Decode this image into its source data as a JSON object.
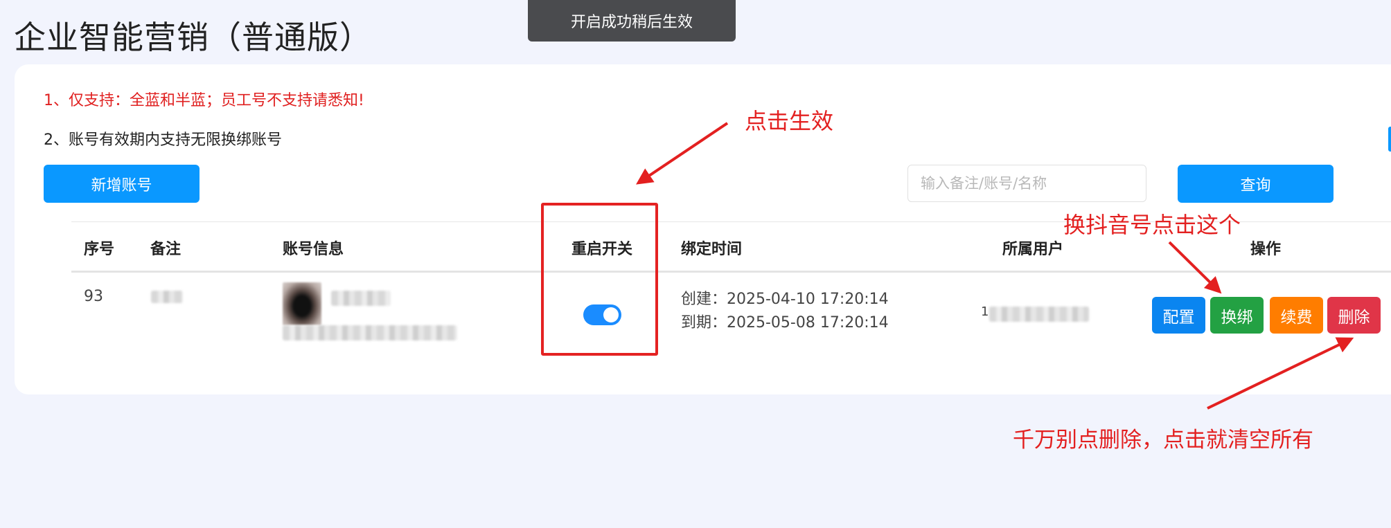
{
  "page": {
    "title": "企业智能营销（普通版）"
  },
  "toast": {
    "message": "开启成功稍后生效"
  },
  "notices": {
    "line1": "1、仅支持：全蓝和半蓝；员工号不支持请悉知!",
    "line2": "2、账号有效期内支持无限换绑账号"
  },
  "toolbar": {
    "add_label": "新增账号",
    "search_placeholder": "输入备注/账号/名称",
    "search_value": "",
    "query_label": "查询"
  },
  "table": {
    "headers": {
      "index": "序号",
      "remark": "备注",
      "account": "账号信息",
      "restart": "重启开关",
      "bind_time": "绑定时间",
      "owner": "所属用户",
      "actions": "操作"
    },
    "rows": [
      {
        "index": "93",
        "created": "创建：2025-04-10 17:20:14",
        "expires": "到期：2025-05-08 17:20:14",
        "owner_prefix": "1",
        "restart_on": true,
        "actions": [
          "配置",
          "换绑",
          "续费",
          "删除"
        ]
      }
    ]
  },
  "annotations": {
    "click_effect": "点击生效",
    "switch_account": "换抖音号点击这个",
    "warning_delete": "千万别点删除，点击就清空所有"
  },
  "colors": {
    "primary": "#0a98ff",
    "config": "#0a85f0",
    "rebind": "#23a143",
    "renew": "#ff7d00",
    "delete": "#e03548",
    "annotation_red": "#e32020",
    "background": "#f2f4fd"
  },
  "icons": {
    "restart_toggle": "toggle-switch-icon"
  }
}
